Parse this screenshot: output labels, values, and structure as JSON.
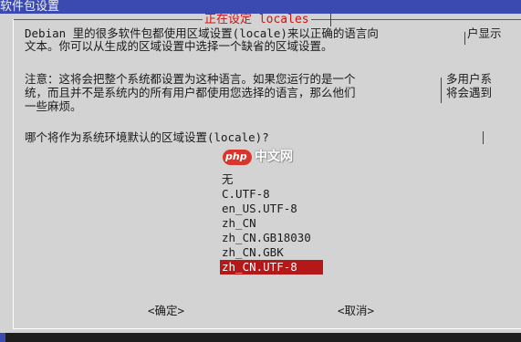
{
  "window": {
    "title": "软件包设置"
  },
  "dialog": {
    "title": "正在设定 locales",
    "intro_lines": [
      "Debian 里的很多软件包都使用区域设置(locale)来以正确的语言向",
      "文本。你可以从生成的区域设置中选择一个缺省的区域设置。"
    ],
    "intro_right": "户显示",
    "note_lines": [
      "注意：这将会把整个系统都设置为这种语言。如果您运行的是一个",
      "统，而且并不是系统内的所有用户都使用您选择的语言，那么他们",
      "一些麻烦。"
    ],
    "note_right_lines": [
      "多用户系",
      "将会遇到"
    ],
    "question": "哪个将作为系统环境默认的区域设置(locale)?",
    "options": [
      {
        "label": "无"
      },
      {
        "label": "C.UTF-8"
      },
      {
        "label": "en_US.UTF-8"
      },
      {
        "label": "zh_CN"
      },
      {
        "label": "zh_CN.GB18030"
      },
      {
        "label": "zh_CN.GBK"
      },
      {
        "label": "zh_CN.UTF-8",
        "selected": true
      }
    ],
    "ok_button": "<确定>",
    "cancel_button": "<取消>"
  },
  "watermark": {
    "badge": "php",
    "text": "中文网"
  },
  "colors": {
    "background": "#3a4ab0",
    "dialog": "#d3d3d3",
    "dialog_title": "#cc1515",
    "selection": "#b41818"
  }
}
